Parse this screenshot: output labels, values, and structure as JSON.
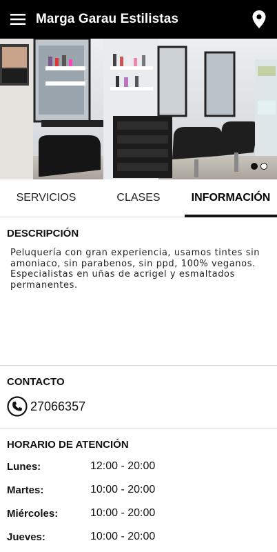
{
  "app": {
    "title": "Marga Garau Estilistas",
    "menu_icon": "hamburger-menu-icon",
    "location_icon": "map-pin-icon"
  },
  "gallery": {
    "image_description": "salon interior photo",
    "page_count": 2,
    "active_index": 0
  },
  "tabs": [
    {
      "label": "SERVICIOS",
      "active": false
    },
    {
      "label": "CLASES",
      "active": false
    },
    {
      "label": "INFORMACIÓN",
      "active": true
    }
  ],
  "descripcion": {
    "title": "DESCRIPCIÓN",
    "text": "Peluquería con gran experiencia, usamos tintes sin amoniaco, sin parabenos, sin ppd, 100% veganos. Especialistas en uñas de acrigel y esmaltados permanentes."
  },
  "contacto": {
    "title": "CONTACTO",
    "phone": "27066357",
    "phone_icon": "phone-icon"
  },
  "horario": {
    "title": "HORARIO DE ATENCIÓN",
    "rows": [
      {
        "day": "Lunes:",
        "hours": "12:00 - 20:00"
      },
      {
        "day": "Martes:",
        "hours": "10:00 - 20:00"
      },
      {
        "day": "Miércoles:",
        "hours": "10:00 - 20:00"
      },
      {
        "day": "Jueves:",
        "hours": "10:00 - 20:00"
      }
    ]
  },
  "colors": {
    "appbar": "#000000",
    "accent": "#111111",
    "divider": "#d8d8d8"
  }
}
